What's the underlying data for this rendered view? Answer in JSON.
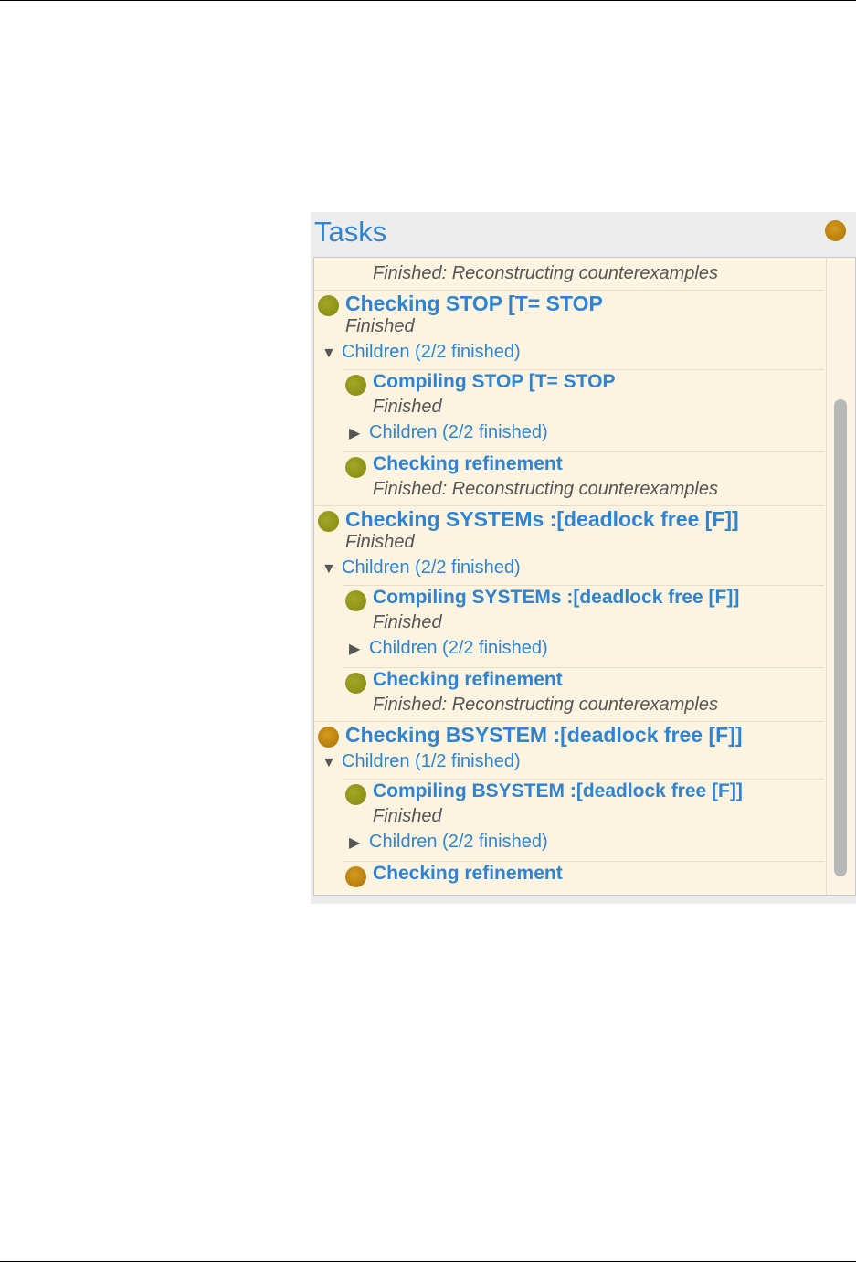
{
  "panel": {
    "title": "Tasks",
    "status_color": "orange"
  },
  "tasks": [
    {
      "kind": "status",
      "text": "Finished: Reconstructing counterexamples",
      "level": 1
    },
    {
      "kind": "title",
      "text": "Checking STOP [T= STOP",
      "status": "green",
      "level": 0
    },
    {
      "kind": "status",
      "text": "Finished",
      "level": 0
    },
    {
      "kind": "children",
      "text": "Children (2/2 finished)",
      "expanded": true,
      "level": 0
    },
    {
      "kind": "title",
      "text": "Compiling STOP [T= STOP",
      "status": "green",
      "level": 1
    },
    {
      "kind": "status",
      "text": "Finished",
      "level": 1
    },
    {
      "kind": "children",
      "text": "Children (2/2 finished)",
      "expanded": false,
      "level": 1
    },
    {
      "kind": "title",
      "text": "Checking refinement",
      "status": "green",
      "level": 1
    },
    {
      "kind": "status",
      "text": "Finished: Reconstructing counterexamples",
      "level": 1
    },
    {
      "kind": "title",
      "text": "Checking SYSTEMs :[deadlock free [F]]",
      "status": "green",
      "level": 0
    },
    {
      "kind": "status",
      "text": "Finished",
      "level": 0
    },
    {
      "kind": "children",
      "text": "Children (2/2 finished)",
      "expanded": true,
      "level": 0
    },
    {
      "kind": "title",
      "text": "Compiling SYSTEMs :[deadlock free [F]]",
      "status": "green",
      "level": 1
    },
    {
      "kind": "status",
      "text": "Finished",
      "level": 1
    },
    {
      "kind": "children",
      "text": "Children (2/2 finished)",
      "expanded": false,
      "level": 1
    },
    {
      "kind": "title",
      "text": "Checking refinement",
      "status": "green",
      "level": 1
    },
    {
      "kind": "status",
      "text": "Finished: Reconstructing counterexamples",
      "level": 1
    },
    {
      "kind": "title",
      "text": "Checking BSYSTEM :[deadlock free [F]]",
      "status": "orange",
      "level": 0
    },
    {
      "kind": "children",
      "text": "Children (1/2 finished)",
      "expanded": true,
      "level": 0
    },
    {
      "kind": "title",
      "text": "Compiling BSYSTEM :[deadlock free [F]]",
      "status": "green",
      "level": 1
    },
    {
      "kind": "status",
      "text": "Finished",
      "level": 1
    },
    {
      "kind": "children",
      "text": "Children (2/2 finished)",
      "expanded": false,
      "level": 1
    },
    {
      "kind": "title",
      "text": "Checking refinement",
      "status": "orange",
      "level": 1
    }
  ],
  "icons": {
    "expanded": "▼",
    "collapsed": "▶"
  },
  "colors": {
    "accent": "#2f83cf",
    "green": "#8a8f14",
    "orange": "#c0850f",
    "list_background": "#fcf4e0"
  }
}
